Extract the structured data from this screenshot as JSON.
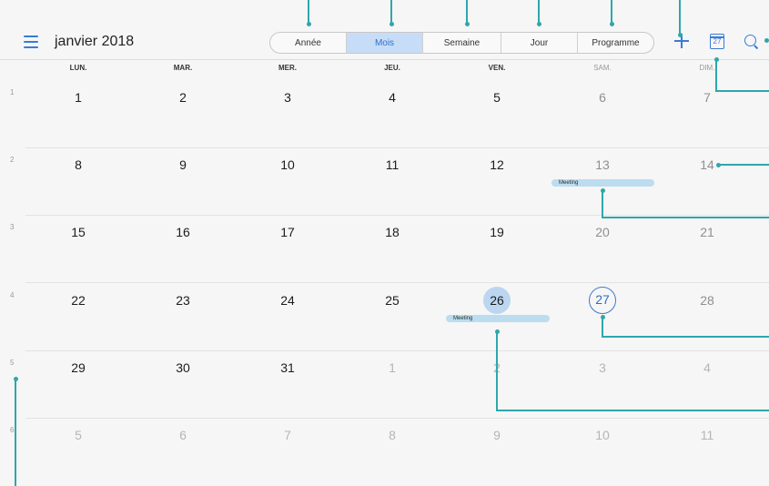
{
  "header": {
    "title": "janvier 2018",
    "menu_icon": "hamburger-menu-icon",
    "tabs": [
      {
        "label": "Année",
        "active": false
      },
      {
        "label": "Mois",
        "active": true
      },
      {
        "label": "Semaine",
        "active": false
      },
      {
        "label": "Jour",
        "active": false
      },
      {
        "label": "Programme",
        "active": false
      }
    ],
    "add_icon": "plus-icon",
    "today_icon": "calendar-today-icon",
    "today_icon_number": "27",
    "search_icon": "search-icon"
  },
  "weekdays": [
    "LUN.",
    "MAR.",
    "MER.",
    "JEU.",
    "VEN.",
    "SAM.",
    "DIM."
  ],
  "weeks": [
    {
      "number": "1",
      "days": [
        "1",
        "2",
        "3",
        "4",
        "5",
        "6",
        "7"
      ]
    },
    {
      "number": "2",
      "days": [
        "8",
        "9",
        "10",
        "11",
        "12",
        "13",
        "14"
      ]
    },
    {
      "number": "3",
      "days": [
        "15",
        "16",
        "17",
        "18",
        "19",
        "20",
        "21"
      ]
    },
    {
      "number": "4",
      "days": [
        "22",
        "23",
        "24",
        "25",
        "26",
        "27",
        "28"
      ]
    },
    {
      "number": "5",
      "days": [
        "29",
        "30",
        "31",
        "1",
        "2",
        "3",
        "4"
      ]
    },
    {
      "number": "6",
      "days": [
        "5",
        "6",
        "7",
        "8",
        "9",
        "10",
        "11"
      ]
    }
  ],
  "selected_day": "26",
  "today": "27",
  "events": [
    {
      "label": "Meeting",
      "week": 1,
      "day_index": 5
    },
    {
      "label": "Meeting",
      "week": 3,
      "day_index": 4
    }
  ],
  "colors": {
    "accent": "#3a7bd5",
    "active_tab": "#c7dcf6",
    "selected_day": "#bcd6f1",
    "event_bar": "#bcdcef",
    "callout": "#2ea7ac"
  }
}
